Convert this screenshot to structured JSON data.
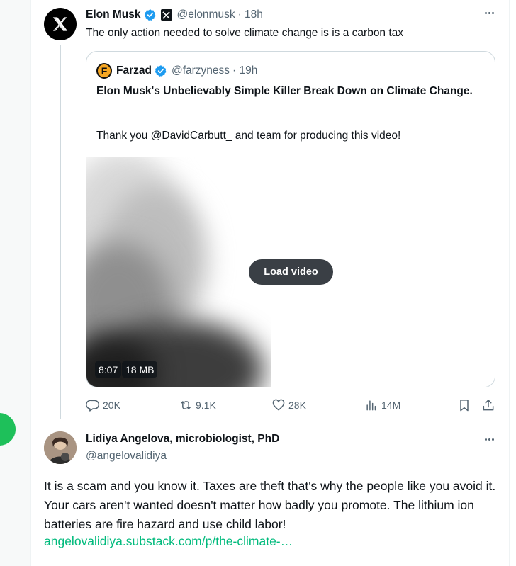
{
  "tweet": {
    "author_name": "Elon Musk",
    "author_handle": "@elonmusk",
    "time": "· 18h",
    "text": "The only action needed to solve climate change is is a carbon tax",
    "icons": {
      "avatar": "x-logo-icon",
      "verified": "verified-badge-icon",
      "affiliate": "x-affiliate-badge-icon",
      "more": "more-icon"
    }
  },
  "quote": {
    "author_name": "Farzad",
    "author_handle": "@farzyness",
    "time": "· 19h",
    "avatar_letter": "F",
    "title": "Elon Musk's Unbelievably Simple Killer Break Down on Climate Change.",
    "body": "Thank you @DavidCarbutt_ and team for producing this video!",
    "video": {
      "load_label": "Load video",
      "duration": "8:07",
      "size": "18 MB"
    }
  },
  "actions": {
    "replies": "20K",
    "reposts": "9.1K",
    "likes": "28K",
    "views": "14M",
    "icons": [
      "reply-icon",
      "repost-icon",
      "like-icon",
      "views-icon",
      "bookmark-icon",
      "share-icon"
    ]
  },
  "reply": {
    "author_name": "Lidiya Angelova, microbiologist, PhD",
    "author_handle": "@angelovalidiya",
    "text": "It is a scam and you know it. Taxes are theft that's why the people like you avoid it.  Your cars aren't wanted doesn't matter how badly you promote. The lithium ion batteries are fire hazard and use child labor!",
    "link": "angelovalidiya.substack.com/p/the-climate-…"
  },
  "colors": {
    "text": "#0f1419",
    "secondary": "#536471",
    "verified": "#1d9bf0",
    "link": "#00ba7c",
    "border": "#cfd9de"
  }
}
